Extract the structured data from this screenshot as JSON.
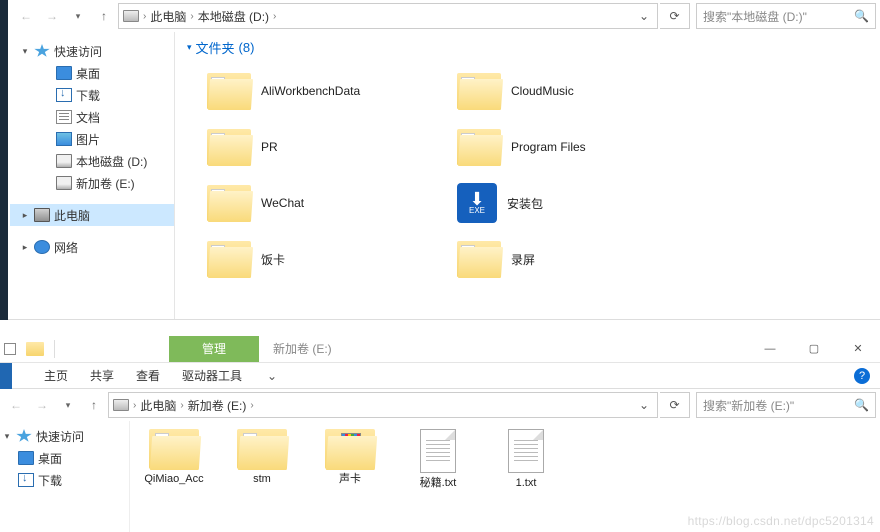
{
  "window1": {
    "breadcrumb": {
      "root": "此电脑",
      "current": "本地磁盘 (D:)"
    },
    "search_placeholder": "搜索\"本地磁盘 (D:)\"",
    "tree": {
      "quick": "快速访问",
      "desktop": "桌面",
      "downloads": "下载",
      "documents": "文档",
      "pictures": "图片",
      "disk_d": "本地磁盘 (D:)",
      "disk_e": "新加卷 (E:)",
      "thispc": "此电脑",
      "network": "网络"
    },
    "group": {
      "label": "文件夹",
      "count": "(8)"
    },
    "folders": [
      {
        "name": "AliWorkbenchData",
        "type": "folder"
      },
      {
        "name": "CloudMusic",
        "type": "folder"
      },
      {
        "name": "PR",
        "type": "folder"
      },
      {
        "name": "Program Files",
        "type": "folder"
      },
      {
        "name": "WeChat",
        "type": "folder"
      },
      {
        "name": "安装包",
        "type": "exe"
      },
      {
        "name": "饭卡",
        "type": "folder"
      },
      {
        "name": "录屏",
        "type": "folder"
      }
    ]
  },
  "window2": {
    "manage_tab": "管理",
    "title": "新加卷 (E:)",
    "ribbon": {
      "home": "主页",
      "share": "共享",
      "view": "查看",
      "drivetools": "驱动器工具"
    },
    "breadcrumb": {
      "root": "此电脑",
      "current": "新加卷 (E:)"
    },
    "search_placeholder": "搜索\"新加卷 (E:)\"",
    "tree": {
      "quick": "快速访问",
      "desktop": "桌面",
      "downloads": "下载"
    },
    "items": [
      {
        "name": "QiMiao_Acc",
        "type": "folder-peek"
      },
      {
        "name": "stm",
        "type": "folder-peek"
      },
      {
        "name": "声卡",
        "type": "folder-stripes"
      },
      {
        "name": "秘籍.txt",
        "type": "file"
      },
      {
        "name": "1.txt",
        "type": "file"
      }
    ]
  },
  "watermark": "https://blog.csdn.net/dpc5201314"
}
